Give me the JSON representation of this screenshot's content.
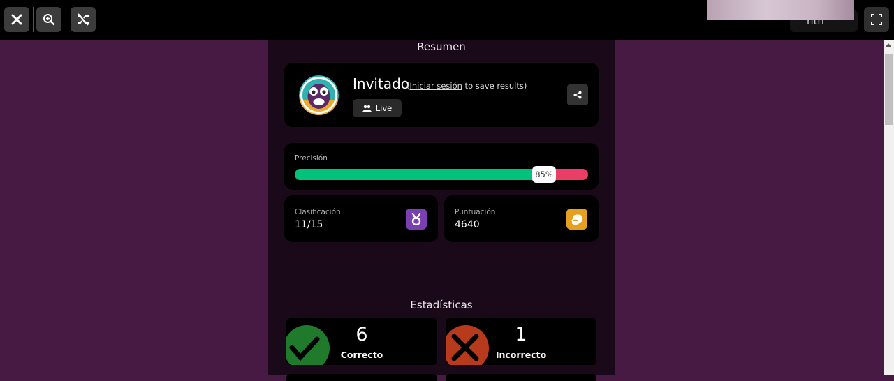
{
  "topbar": {
    "close_icon": "close-icon",
    "zoom_icon": "zoom-in-icon",
    "shuffle_icon": "shuffle-off-icon",
    "right_pill_text": "nth",
    "fullscreen_icon": "fullscreen-icon"
  },
  "summary": {
    "title": "Resumen",
    "player_name": "Invitado",
    "login_open": "(",
    "login_link": "Iniciar sesión",
    "login_rest": " to save results)",
    "live_label": "Live"
  },
  "accuracy": {
    "label": "Precisión",
    "value_text": "85%",
    "value": 0.85,
    "colors": {
      "correct": "#00c27a",
      "incorrect": "#ec3d66"
    }
  },
  "rank": {
    "label": "Clasificación",
    "value": "11/15",
    "icon": "medal-icon",
    "color": "#7a3fb0"
  },
  "score": {
    "label": "Puntuación",
    "value": "4640",
    "icon": "coins-icon",
    "color": "#e5a020"
  },
  "stats": {
    "title": "Estadísticas",
    "correct": {
      "count": "6",
      "label": "Correcto",
      "color": "#1f7a2c"
    },
    "incorrect": {
      "count": "1",
      "label": "Incorrecto",
      "color": "#b83a1d"
    }
  },
  "colors": {
    "page_bg": "#461a42",
    "panel_bg": "#1a0918",
    "card_bg": "#000000"
  }
}
